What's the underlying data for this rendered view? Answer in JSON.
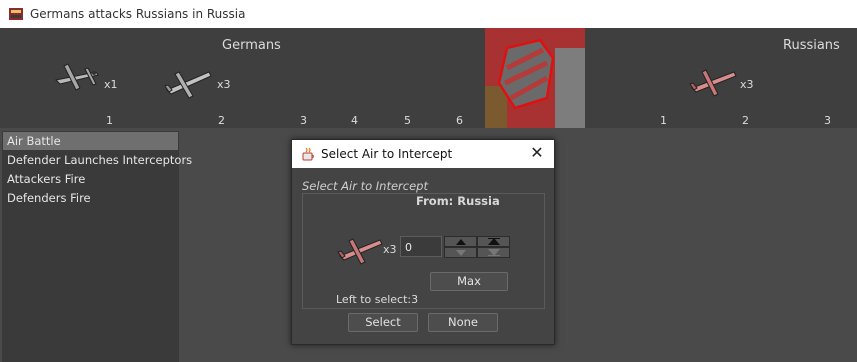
{
  "window": {
    "title": "Germans attacks Russians in Russia",
    "icon": "game-flag-icon"
  },
  "battle": {
    "attacker_name": "Germans",
    "defender_name": "Russians",
    "attacker_units": [
      {
        "icon": "german-bomber-icon",
        "count": "x1"
      },
      {
        "icon": "german-fighter-icon",
        "count": "x3"
      }
    ],
    "defender_units": [
      {
        "icon": "russian-fighter-icon",
        "count": "x3"
      }
    ],
    "attacker_dice": [
      "1",
      "2",
      "3",
      "4",
      "5",
      "6"
    ],
    "defender_dice": [
      "1",
      "2",
      "3"
    ]
  },
  "steps": [
    "Air Battle",
    "Defender Launches Interceptors",
    "Attackers Fire",
    "Defenders Fire"
  ],
  "dialog": {
    "title": "Select Air to Intercept",
    "group_label": "Select Air to Intercept",
    "from_label": "From: Russia",
    "unit_icon": "russian-fighter-icon",
    "unit_count": "x3",
    "value": "0",
    "max_label": "Max",
    "left_to_select": "Left to select:3",
    "select_label": "Select",
    "none_label": "None",
    "close_icon": "close-icon"
  },
  "colors": {
    "russian_red": "#c0392b",
    "german_grey": "#9a9a9a",
    "selected_step": "#6f6f6f"
  }
}
